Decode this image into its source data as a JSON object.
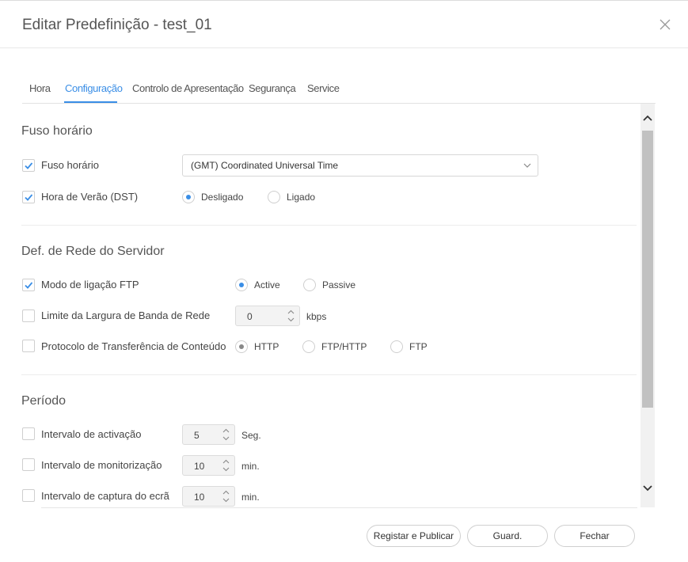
{
  "dialog": {
    "title": "Editar Predefinição - test_01"
  },
  "tabs": [
    {
      "label": "Hora",
      "active": false
    },
    {
      "label": "Configuração",
      "active": true
    },
    {
      "label": "Controlo de Apresentação",
      "active": false
    },
    {
      "label": "Segurança",
      "active": false
    },
    {
      "label": "Service",
      "active": false
    }
  ],
  "timezone_section": {
    "title": "Fuso horário",
    "timezone": {
      "label": "Fuso horário",
      "checked": true,
      "selected": "(GMT) Coordinated Universal Time"
    },
    "dst": {
      "label": "Hora de Verão (DST)",
      "checked": true,
      "options": [
        "Desligado",
        "Ligado"
      ],
      "selected": "Desligado"
    }
  },
  "network_section": {
    "title": "Def. de Rede do Servidor",
    "ftp_mode": {
      "label": "Modo de ligação FTP",
      "checked": true,
      "options": [
        "Active",
        "Passive"
      ],
      "selected": "Active"
    },
    "bandwidth": {
      "label": "Limite da Largura de Banda de Rede",
      "checked": false,
      "value": "0",
      "unit": "kbps"
    },
    "protocol": {
      "label": "Protocolo de Transferência de Conteúdo",
      "checked": false,
      "options": [
        "HTTP",
        "FTP/HTTP",
        "FTP"
      ],
      "selected": "HTTP"
    }
  },
  "period_section": {
    "title": "Período",
    "activation": {
      "label": "Intervalo de activação",
      "checked": false,
      "value": "5",
      "unit": "Seg."
    },
    "monitoring": {
      "label": "Intervalo de monitorização",
      "checked": false,
      "value": "10",
      "unit": "min."
    },
    "capture": {
      "label": "Intervalo de captura do ecrã",
      "checked": false,
      "value": "10",
      "unit": "min."
    }
  },
  "buttons": {
    "register_publish": "Registar e Publicar",
    "save": "Guard.",
    "close": "Fechar"
  },
  "colors": {
    "accent": "#3a8ee6",
    "scroll_thumb": "#c1c1c1"
  },
  "icons": [
    "close-icon",
    "check-icon",
    "chevron-down-icon",
    "spinner-up-icon",
    "spinner-down-icon",
    "scroll-up-icon",
    "scroll-down-icon"
  ]
}
